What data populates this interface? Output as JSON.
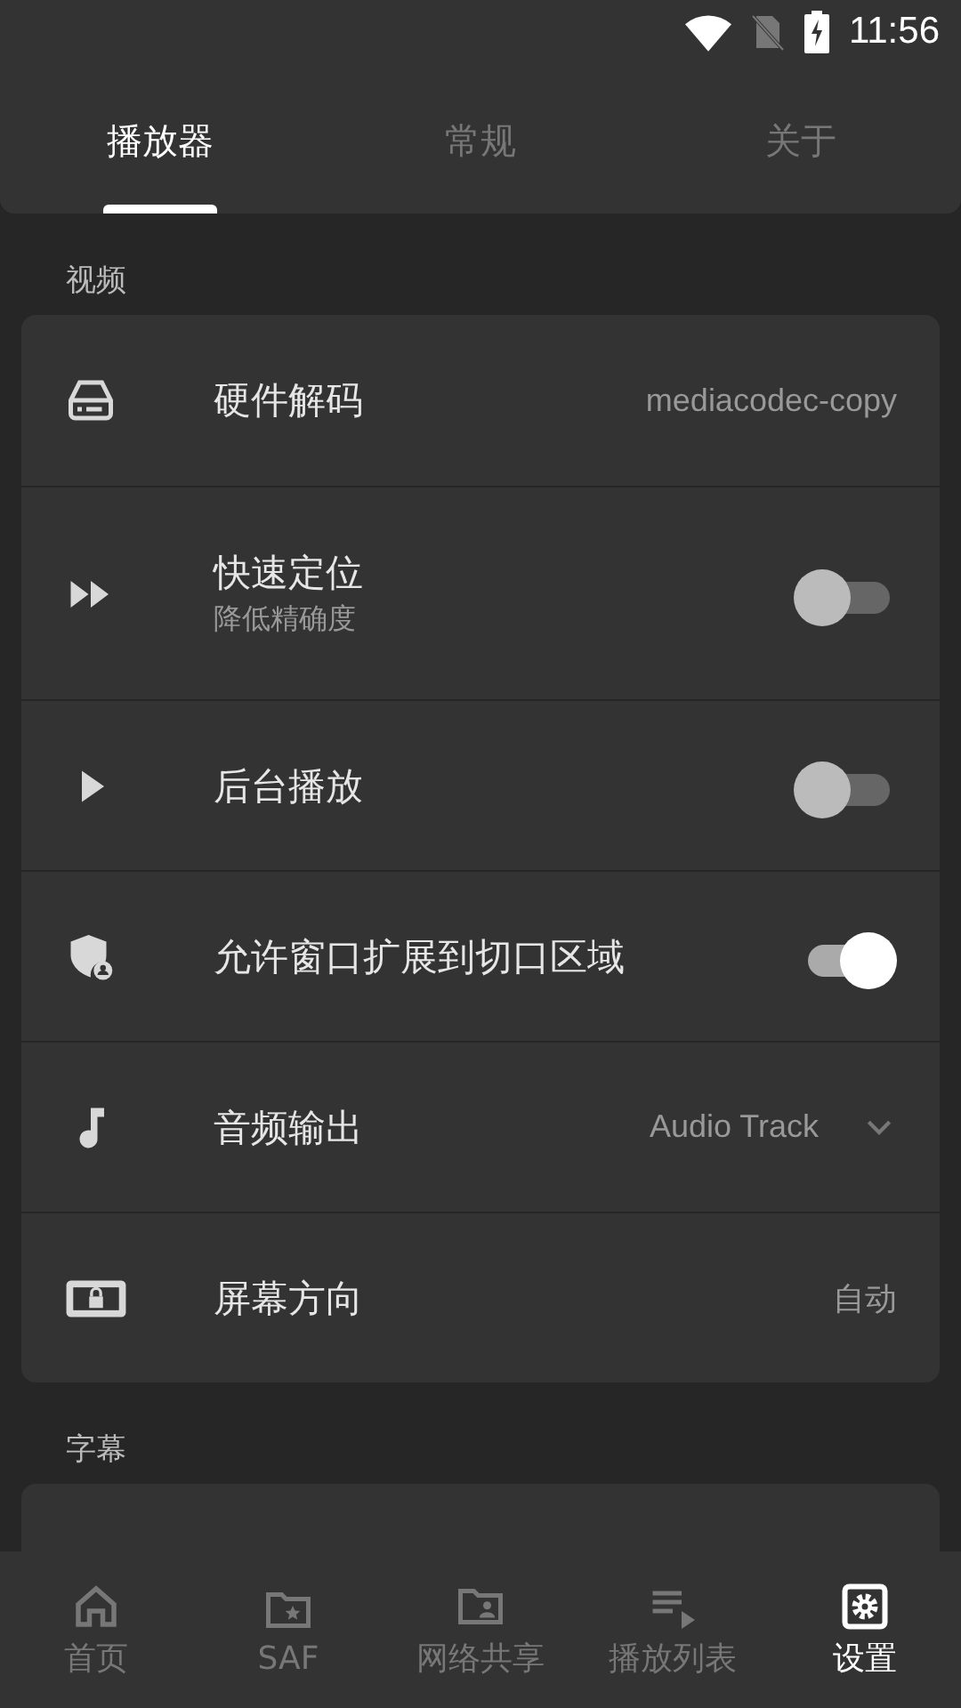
{
  "status_bar": {
    "time": "11:56"
  },
  "tabs": [
    {
      "label": "播放器",
      "selected": true
    },
    {
      "label": "常规",
      "selected": false
    },
    {
      "label": "关于",
      "selected": false
    }
  ],
  "sections": [
    {
      "title": "视频",
      "items": [
        {
          "kind": "value",
          "title": "硬件解码",
          "value": "mediacodec-copy"
        },
        {
          "kind": "toggle",
          "title": "快速定位",
          "subtitle": "降低精确度",
          "on": false
        },
        {
          "kind": "toggle",
          "title": "后台播放",
          "on": false
        },
        {
          "kind": "toggle",
          "title": "允许窗口扩展到切口区域",
          "on": true
        },
        {
          "kind": "dropdown",
          "title": "音频输出",
          "value": "Audio Track"
        },
        {
          "kind": "value",
          "title": "屏幕方向",
          "value": "自动"
        }
      ]
    },
    {
      "title": "字幕"
    }
  ],
  "bottom_nav": [
    {
      "label": "首页",
      "selected": false
    },
    {
      "label": "SAF",
      "selected": false
    },
    {
      "label": "网络共享",
      "selected": false
    },
    {
      "label": "播放列表",
      "selected": false
    },
    {
      "label": "设置",
      "selected": true
    }
  ]
}
